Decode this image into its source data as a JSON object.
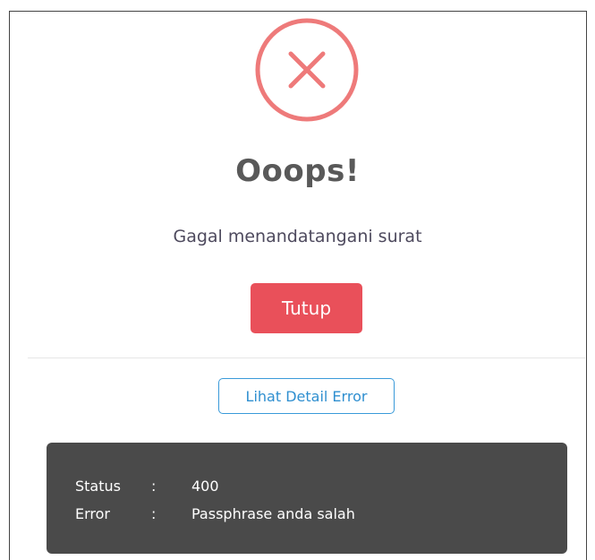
{
  "dialog": {
    "title": "Ooops!",
    "message": "Gagal menandatangani surat",
    "close_label": "Tutup",
    "detail_button_label": "Lihat Detail Error",
    "icon": "close-circle-icon",
    "colors": {
      "icon": "#ee7a7a",
      "close_button": "#e9505a",
      "detail_button": "#3a9ad9",
      "panel": "#4a4a4a"
    }
  },
  "error_detail": {
    "separator": ":",
    "rows": [
      {
        "label": "Status",
        "value": "400"
      },
      {
        "label": "Error",
        "value": "Passphrase anda salah"
      }
    ]
  }
}
